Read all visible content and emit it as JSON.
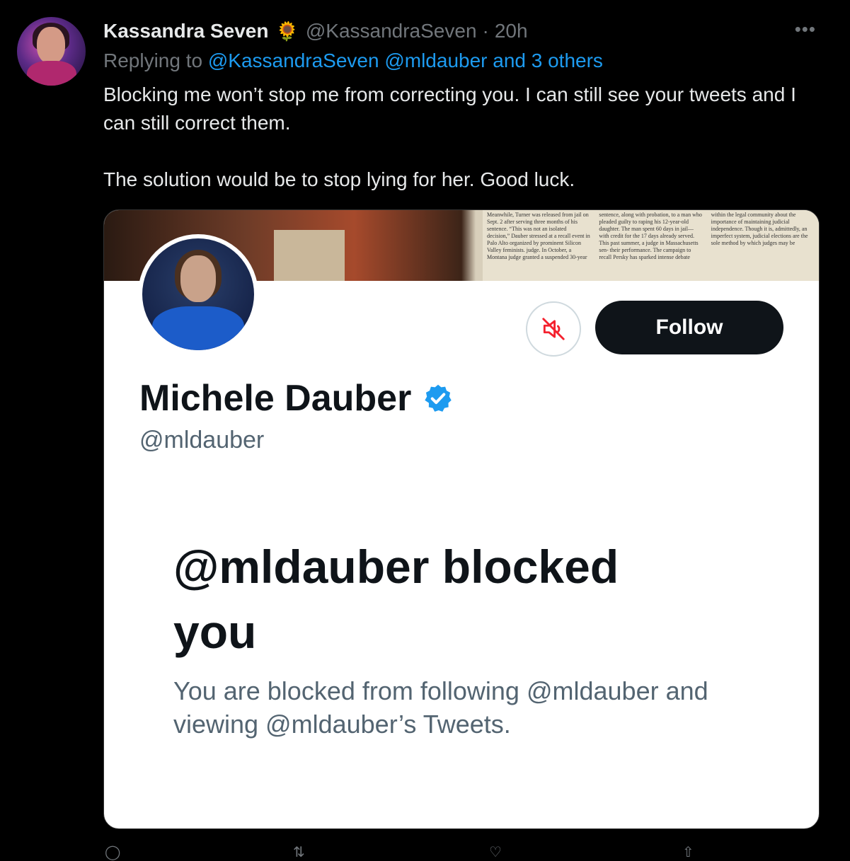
{
  "tweet": {
    "display_name": "Kassandra Seven",
    "name_emoji": "🌻",
    "handle": "@KassandraSeven",
    "separator": "·",
    "time": "20h",
    "more_label": "•••",
    "replying_to_prefix": "Replying to",
    "replying_to_mentions": "@KassandraSeven @mldauber and 3 others",
    "text_p1": "Blocking me won’t stop me from correcting you. I can still see your tweets and I can still correct them.",
    "text_p2": "The solution would be to stop lying for her. Good luck."
  },
  "media": {
    "banner_newspaper_text": "Meanwhile, Turner was released from jail on Sept. 2 after serving three months of his sentence. “This was not an isolated decision,” Dauber stressed at a recall event in Palo Alto organized by prominent Silicon Valley feminists. judge. In October, a Montana judge granted a suspended 30-year sentence, along with probation, to a man who pleaded guilty to raping his 12-year-old daughter. The man spent 60 days in jail—with credit for the 17 days already served. This past summer, a judge in Massachusetts sen- their performance. The campaign to recall Persky has sparked intense debate within the legal community about the importance of maintaining judicial independence. Though it is, admittedly, an imperfect system, judicial elections are the sole method by which judges may be",
    "follow_label": "Follow",
    "profile_name": "Michele Dauber",
    "profile_handle": "@mldauber",
    "blocked_title": "@mldauber blocked you",
    "blocked_description": "You are blocked from following @mldauber and viewing @mldauber’s Tweets."
  },
  "colors": {
    "background": "#000000",
    "mention_blue": "#1d9bf0",
    "muted_gray": "#71767b",
    "follow_button": "#0f1419",
    "mute_icon_red": "#f4212e"
  },
  "icons": {
    "mute": "speaker-muted-icon",
    "verified": "verified-badge-icon"
  }
}
